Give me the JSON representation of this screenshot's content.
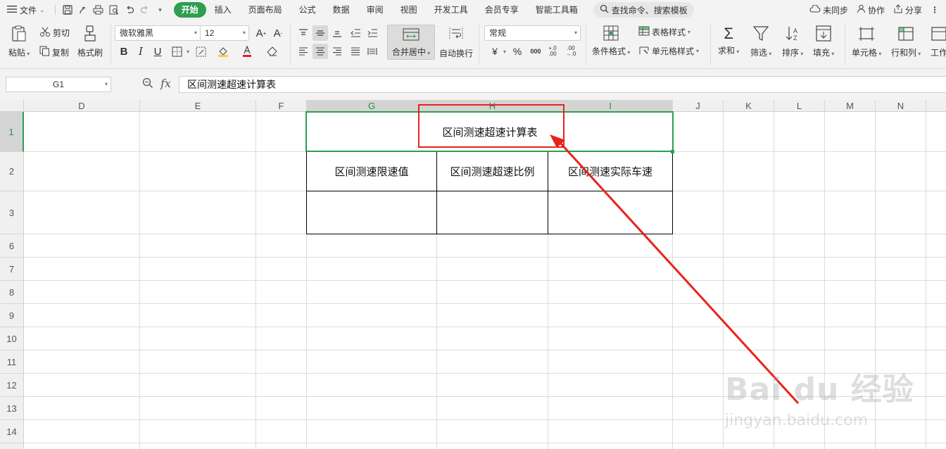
{
  "menubar": {
    "file_label": "文件",
    "tabs": [
      {
        "label": "开始",
        "active": true
      },
      {
        "label": "插入",
        "active": false
      },
      {
        "label": "页面布局",
        "active": false
      },
      {
        "label": "公式",
        "active": false
      },
      {
        "label": "数据",
        "active": false
      },
      {
        "label": "审阅",
        "active": false
      },
      {
        "label": "视图",
        "active": false
      },
      {
        "label": "开发工具",
        "active": false
      },
      {
        "label": "会员专享",
        "active": false
      },
      {
        "label": "智能工具箱",
        "active": false
      }
    ],
    "search_label": "查找命令、搜索模板",
    "unsync_label": "未同步",
    "collab_label": "协作",
    "share_label": "分享"
  },
  "ribbon": {
    "paste_label": "粘贴",
    "cut_label": "剪切",
    "copy_label": "复制",
    "format_painter_label": "格式刷",
    "font_name": "微软雅黑",
    "font_size": "12",
    "merge_center_label": "合并居中",
    "wrap_label": "自动换行",
    "number_format": "常规",
    "cond_format_label": "条件格式",
    "table_style_label": "表格样式",
    "cell_style_label": "单元格样式",
    "sum_label": "求和",
    "filter_label": "筛选",
    "sort_label": "排序",
    "fill_label": "填充",
    "cell_label": "单元格",
    "rowcol_label": "行和列",
    "worksheet_label": "工作"
  },
  "formula_bar": {
    "name_box": "G1",
    "fx": "fx",
    "content": "区间测速超速计算表"
  },
  "sheet": {
    "columns": [
      "D",
      "E",
      "F",
      "G",
      "H",
      "I",
      "J",
      "K",
      "L",
      "M",
      "N"
    ],
    "rows": [
      "1",
      "2",
      "3",
      "6",
      "7",
      "8",
      "9",
      "10",
      "11",
      "12",
      "13",
      "14"
    ],
    "title": "区间测速超速计算表",
    "headers": [
      "区间测速限速值",
      "区间测速超速比例",
      "区间测速实际车速"
    ]
  },
  "watermark": {
    "brand": "Bai du 经验",
    "url": "jingyan.baidu.com"
  },
  "colors": {
    "accent_green": "#2e9e4f",
    "annotation_red": "#e8221b"
  }
}
